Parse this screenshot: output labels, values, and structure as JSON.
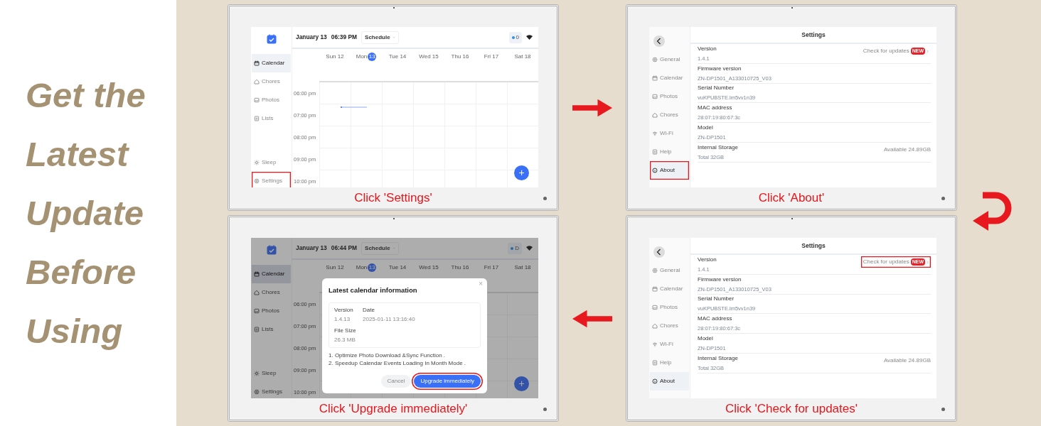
{
  "headline": [
    "Get the",
    "Latest",
    "Update",
    "Before",
    "Using"
  ],
  "panels": [
    {
      "kind": "calendar",
      "date": "January 13",
      "time": "06:39 PM",
      "view": "Schedule",
      "badge": "0",
      "sidebar": {
        "top": [
          {
            "label": "Calendar",
            "selected": true,
            "highlighted": false
          },
          {
            "label": "Chores",
            "selected": false,
            "highlighted": false
          },
          {
            "label": "Photos",
            "selected": false,
            "highlighted": false
          },
          {
            "label": "Lists",
            "selected": false,
            "highlighted": false
          }
        ],
        "bottom": [
          {
            "label": "Sleep",
            "selected": false,
            "highlighted": false
          },
          {
            "label": "Settings",
            "selected": false,
            "highlighted": true
          }
        ]
      },
      "days": [
        {
          "name": "Sun",
          "num": "12",
          "today": false
        },
        {
          "name": "Mon",
          "num": "13",
          "today": true
        },
        {
          "name": "Tue",
          "num": "14",
          "today": false
        },
        {
          "name": "Wed",
          "num": "15",
          "today": false
        },
        {
          "name": "Thu",
          "num": "16",
          "today": false
        },
        {
          "name": "Fri",
          "num": "17",
          "today": false
        },
        {
          "name": "Sat",
          "num": "18",
          "today": false
        }
      ],
      "times": [
        "06:00 pm",
        "07:00 pm",
        "08:00 pm",
        "09:00 pm",
        "10:00 pm"
      ],
      "fab": "+",
      "caption": "Click 'Settings'"
    },
    {
      "kind": "settings",
      "title": "Settings",
      "sidebar": [
        {
          "label": "General",
          "selected": false,
          "highlighted": false
        },
        {
          "label": "Calendar",
          "selected": false,
          "highlighted": false
        },
        {
          "label": "Photos",
          "selected": false,
          "highlighted": false
        },
        {
          "label": "Chores",
          "selected": false,
          "highlighted": false
        },
        {
          "label": "Wi-Fi",
          "selected": false,
          "highlighted": false
        },
        {
          "label": "Help",
          "selected": false,
          "highlighted": false
        },
        {
          "label": "About",
          "selected": true,
          "highlighted": true
        }
      ],
      "rows": [
        {
          "label": "Version",
          "value": "1.4.1",
          "action": "Check for updates",
          "badge": "NEW",
          "highlighted": false
        },
        {
          "label": "Firmware version",
          "value": "ZN-DP1501_A133010725_V03"
        },
        {
          "label": "Serial Number",
          "value": "vuKPUBSTE.lm5vv1n39"
        },
        {
          "label": "MAC address",
          "value": "28:07:19:80:67:3c"
        },
        {
          "label": "Model",
          "value": "ZN-DP1501"
        },
        {
          "label": "Internal Storage",
          "value": "Total 32GB",
          "extra": "Available 24.89GB"
        }
      ],
      "caption": "Click 'About'"
    },
    {
      "kind": "calendar",
      "date": "January 13",
      "time": "06:44 PM",
      "view": "Schedule",
      "badge": "D",
      "sidebar": {
        "top": [
          {
            "label": "Calendar",
            "selected": true,
            "highlighted": false
          },
          {
            "label": "Chores",
            "selected": false,
            "highlighted": false
          },
          {
            "label": "Photos",
            "selected": false,
            "highlighted": false
          },
          {
            "label": "Lists",
            "selected": false,
            "highlighted": false
          }
        ],
        "bottom": [
          {
            "label": "Sleep",
            "selected": false,
            "highlighted": false
          },
          {
            "label": "Settings",
            "selected": false,
            "highlighted": false
          }
        ]
      },
      "days": [
        {
          "name": "Sun",
          "num": "12",
          "today": false
        },
        {
          "name": "Mon",
          "num": "13",
          "today": true
        },
        {
          "name": "Tue",
          "num": "14",
          "today": false
        },
        {
          "name": "Wed",
          "num": "15",
          "today": false
        },
        {
          "name": "Thu",
          "num": "16",
          "today": false
        },
        {
          "name": "Fri",
          "num": "17",
          "today": false
        },
        {
          "name": "Sat",
          "num": "18",
          "today": false
        }
      ],
      "times": [
        "06:00 pm",
        "07:00 pm",
        "08:00 pm",
        "09:00 pm",
        "10:00 pm"
      ],
      "fab": "+",
      "dialog": {
        "title": "Latest calendar information",
        "close": "×",
        "fields": [
          {
            "label": "Version",
            "value": "1.4.13"
          },
          {
            "label": "Date",
            "value": "2025-01-11 13:16:40"
          },
          {
            "label": "File Size",
            "value": "26.3 MB"
          }
        ],
        "notes": [
          "1. Optimize Photo Download &Sync Function .",
          "2. Speedup Calendar Events Loading In Month Mode ."
        ],
        "buttons": [
          {
            "label": "Cancel",
            "primary": false,
            "highlighted": false
          },
          {
            "label": "Upgrade immediately",
            "primary": true,
            "highlighted": true
          }
        ]
      },
      "caption": "Click 'Upgrade immediately'"
    },
    {
      "kind": "settings",
      "title": "Settings",
      "sidebar": [
        {
          "label": "General",
          "selected": false,
          "highlighted": false
        },
        {
          "label": "Calendar",
          "selected": false,
          "highlighted": false
        },
        {
          "label": "Photos",
          "selected": false,
          "highlighted": false
        },
        {
          "label": "Chores",
          "selected": false,
          "highlighted": false
        },
        {
          "label": "Wi-Fi",
          "selected": false,
          "highlighted": false
        },
        {
          "label": "Help",
          "selected": false,
          "highlighted": false
        },
        {
          "label": "About",
          "selected": true,
          "highlighted": false
        }
      ],
      "rows": [
        {
          "label": "Version",
          "value": "1.4.1",
          "action": "Check for updates",
          "badge": "NEW",
          "highlighted": true
        },
        {
          "label": "Firmware version",
          "value": "ZN-DP1501_A133010725_V03"
        },
        {
          "label": "Serial Number",
          "value": "vuKPUBSTE.lm5vv1n39"
        },
        {
          "label": "MAC address",
          "value": "28:07:19:80:67:3c"
        },
        {
          "label": "Model",
          "value": "ZN-DP1501"
        },
        {
          "label": "Internal Storage",
          "value": "Total 32GB",
          "extra": "Available 24.89GB"
        }
      ],
      "caption": "Click 'Check for updates'"
    }
  ]
}
